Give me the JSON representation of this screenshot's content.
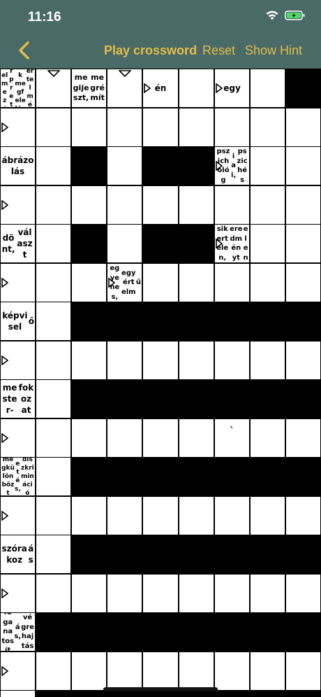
{
  "status": {
    "time": "11:16"
  },
  "colors": {
    "bar": "#4a6a68",
    "accent": "#e2bd47"
  },
  "nav": {
    "title": "Play crossword",
    "reset": "Reset",
    "hint": "Show Hint",
    "back_icon": "chevron-left-icon"
  },
  "grid": {
    "rows": 17,
    "cols": 9,
    "black": [
      [
        0,
        8
      ],
      [
        2,
        2
      ],
      [
        2,
        4
      ],
      [
        2,
        5
      ],
      [
        4,
        2
      ],
      [
        4,
        4
      ],
      [
        4,
        5
      ],
      [
        6,
        2
      ],
      [
        6,
        3
      ],
      [
        6,
        4
      ],
      [
        6,
        5
      ],
      [
        6,
        6
      ],
      [
        6,
        7
      ],
      [
        6,
        8
      ],
      [
        8,
        2
      ],
      [
        8,
        3
      ],
      [
        8,
        4
      ],
      [
        8,
        5
      ],
      [
        8,
        6
      ],
      [
        8,
        7
      ],
      [
        8,
        8
      ],
      [
        10,
        2
      ],
      [
        10,
        3
      ],
      [
        10,
        4
      ],
      [
        10,
        5
      ],
      [
        10,
        6
      ],
      [
        10,
        7
      ],
      [
        10,
        8
      ],
      [
        12,
        2
      ],
      [
        12,
        3
      ],
      [
        12,
        4
      ],
      [
        12,
        5
      ],
      [
        12,
        6
      ],
      [
        12,
        7
      ],
      [
        12,
        8
      ],
      [
        14,
        1
      ],
      [
        14,
        2
      ],
      [
        14,
        3
      ],
      [
        14,
        4
      ],
      [
        14,
        5
      ],
      [
        14,
        6
      ],
      [
        14,
        7
      ],
      [
        14,
        8
      ],
      [
        16,
        1
      ],
      [
        16,
        2
      ],
      [
        16,
        3
      ],
      [
        16,
        4
      ],
      [
        16,
        5
      ],
      [
        16,
        6
      ],
      [
        16,
        7
      ],
      [
        16,
        8
      ]
    ],
    "clues": [
      {
        "r": 0,
        "c": 0,
        "lines": [
          "értelmezés,",
          "interpretáció",
          "vminek megfelelően,",
          "vmi értelmében"
        ],
        "size": 9
      },
      {
        "r": 0,
        "c": 2,
        "lines": [
          "megijeszt,",
          "megrémít"
        ],
        "size": 11
      },
      {
        "r": 0,
        "c": 4,
        "lines": [
          "én"
        ],
        "size": 12
      },
      {
        "r": 0,
        "c": 6,
        "lines": [
          "egy"
        ],
        "size": 12
      },
      {
        "r": 2,
        "c": 0,
        "lines": [
          "ábrázolás"
        ],
        "size": 12
      },
      {
        "r": 2,
        "c": 6,
        "lines": [
          "pszichológ",
          "iai,",
          "pszichés"
        ],
        "size": 10
      },
      {
        "r": 4,
        "c": 0,
        "lines": [
          "dönt,",
          "választ"
        ],
        "size": 12
      },
      {
        "r": 4,
        "c": 6,
        "lines": [
          "sikertelen,",
          "eredményt",
          "elen"
        ],
        "size": 10
      },
      {
        "r": 5,
        "c": 3,
        "lines": [
          "egyenes,",
          "egyértelm",
          "ű"
        ],
        "size": 10
      },
      {
        "r": 6,
        "c": 0,
        "lines": [
          "képvisel",
          "ő"
        ],
        "size": 12
      },
      {
        "r": 8,
        "c": 0,
        "lines": [
          "mester-",
          "fokozat"
        ],
        "size": 12
      },
      {
        "r": 10,
        "c": 0,
        "lines": [
          "megkülönbözt",
          "etés,",
          "diszkrimináció"
        ],
        "size": 9
      },
      {
        "r": 12,
        "c": 0,
        "lines": [
          "szórakoz",
          "ás"
        ],
        "size": 12
      },
      {
        "r": 14,
        "c": 0,
        "lines": [
          "foganatosít",
          "ás,",
          "végrehajtás"
        ],
        "size": 10
      }
    ],
    "arrows_right": [
      [
        0,
        4
      ],
      [
        0,
        6
      ],
      [
        1,
        0
      ],
      [
        2,
        6
      ],
      [
        3,
        0
      ],
      [
        4,
        6
      ],
      [
        5,
        0
      ],
      [
        5,
        3
      ],
      [
        7,
        0
      ],
      [
        9,
        0
      ],
      [
        11,
        0
      ],
      [
        13,
        0
      ],
      [
        15,
        0
      ]
    ],
    "arrows_down": [
      [
        0,
        1
      ],
      [
        0,
        3
      ]
    ],
    "marks": [
      {
        "r": 9,
        "c": 6,
        "text": "`"
      }
    ]
  }
}
